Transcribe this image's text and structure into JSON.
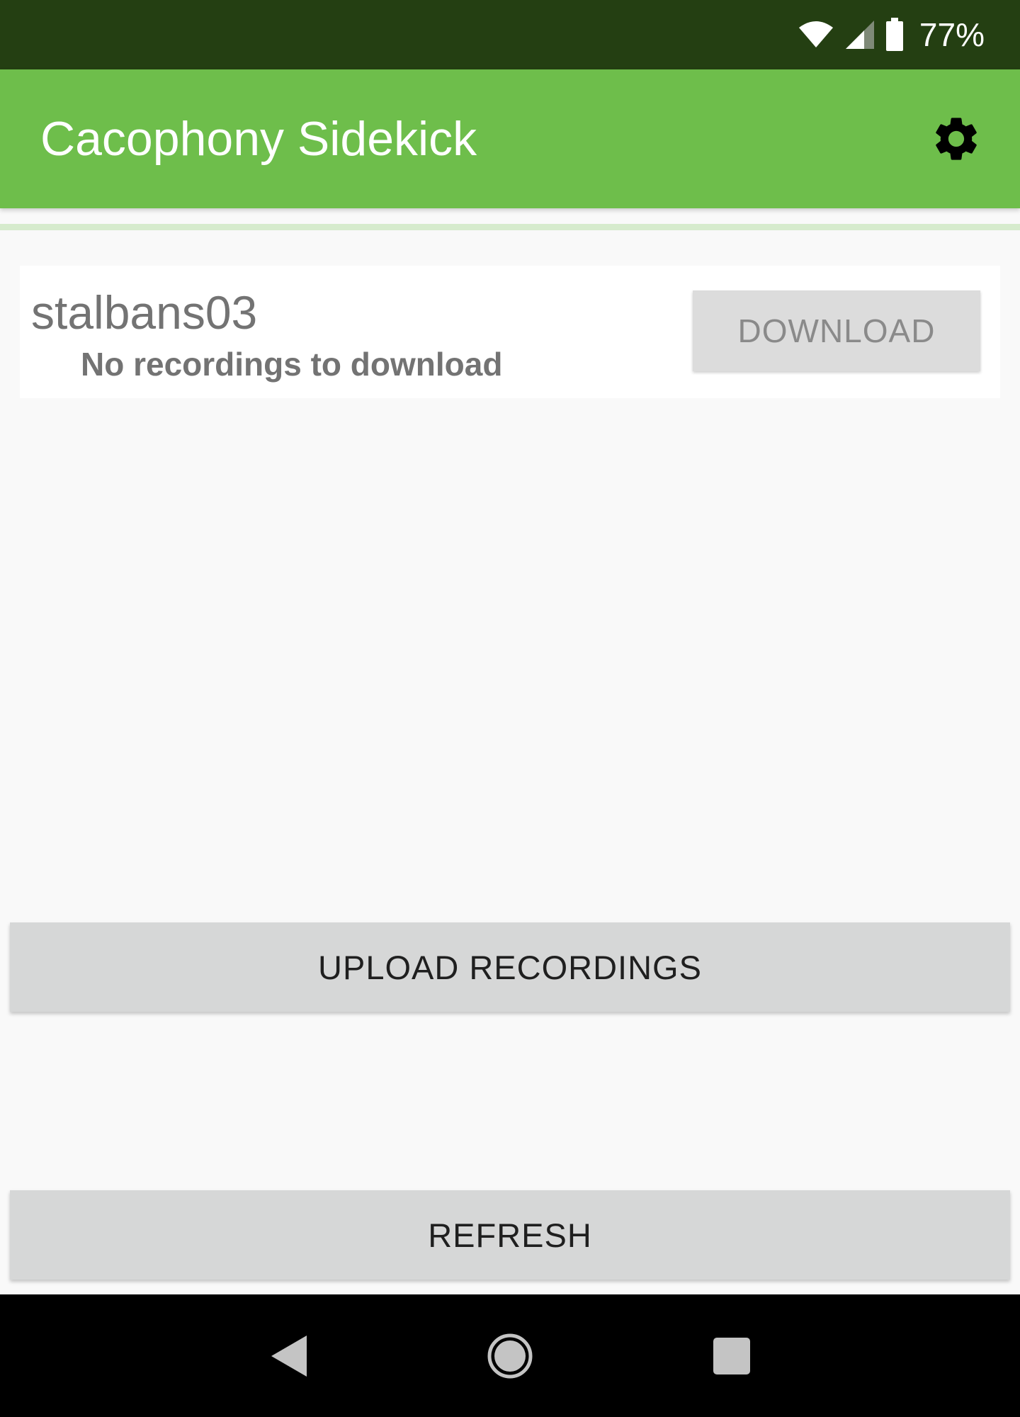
{
  "status_bar": {
    "battery_percent": "77%",
    "icons": [
      "wifi-icon",
      "cell-signal-icon",
      "battery-icon"
    ]
  },
  "app_bar": {
    "title": "Cacophony Sidekick",
    "settings_icon": "gear-icon",
    "background_color": "#6ebe4b"
  },
  "devices": [
    {
      "name": "stalbans03",
      "status": "No recordings to download",
      "action_label": "DOWNLOAD"
    }
  ],
  "actions": {
    "upload_label": "UPLOAD RECORDINGS",
    "refresh_label": "REFRESH"
  },
  "nav_bar": {
    "icons": [
      "back-icon",
      "home-icon",
      "recents-icon"
    ]
  }
}
